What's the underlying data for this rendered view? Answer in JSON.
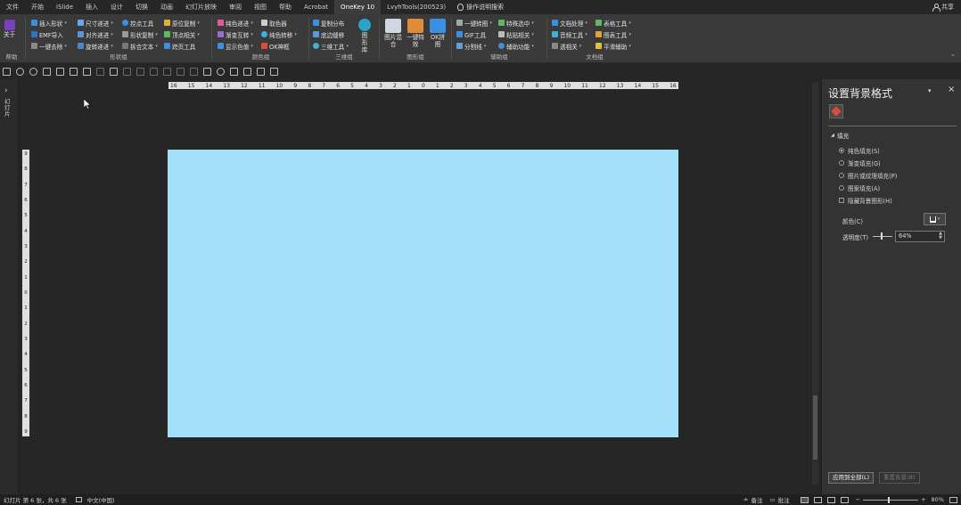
{
  "tabs": [
    "文件",
    "开始",
    "iSlide",
    "插入",
    "设计",
    "切换",
    "动画",
    "幻灯片放映",
    "审阅",
    "视图",
    "帮助",
    "Acrobat",
    "OneKey 10",
    "LvyhTools(200523)"
  ],
  "active_tab": "OneKey 10",
  "search_label": "操作说明搜索",
  "share_label": "共享",
  "ribbon": {
    "help_group": {
      "button": "关于",
      "title": "帮助"
    },
    "shape_group": {
      "title": "形状组",
      "col1": [
        "插入形状",
        "EMF导入",
        "一键去除"
      ],
      "col2": [
        "尺寸递进",
        "对齐递进",
        "旋转递进"
      ],
      "col3": [
        "控点工具",
        "形状复制",
        "拆合文本"
      ],
      "col4": [
        "原位复制",
        "顶点相关",
        "跨页工具"
      ]
    },
    "color_group": {
      "title": "颜色组",
      "col1": [
        "纯色递进",
        "渐变互转",
        "显示色值"
      ],
      "col2": [
        "取色器",
        "纯色转移",
        "OK神框"
      ]
    },
    "three_d_group": {
      "title": "三维组",
      "col1": [
        "复制分布",
        "底边缝移",
        "三维工具"
      ],
      "big": "图形库"
    },
    "image_group": {
      "title": "图形组",
      "big1": "图片混合",
      "big2": "一键特效",
      "big3": "OK拼图"
    },
    "assist_group": {
      "title": "辅助组",
      "col1": [
        "一键转图",
        "GIF工具",
        "分割线"
      ],
      "col2": [
        "特殊选中",
        "粘贴相关",
        "辅助功能"
      ]
    },
    "doc_group": {
      "title": "文档组",
      "col1": [
        "文档处理",
        "音频工具",
        "透相关"
      ],
      "col2": [
        "表格工具",
        "图表工具",
        "平滑辅助"
      ]
    }
  },
  "left_pane": {
    "label": "幻灯片"
  },
  "hruler_ticks": [
    "16",
    "15",
    "14",
    "13",
    "12",
    "11",
    "10",
    "9",
    "8",
    "7",
    "6",
    "5",
    "4",
    "3",
    "2",
    "1",
    "0",
    "1",
    "2",
    "3",
    "4",
    "5",
    "6",
    "7",
    "8",
    "9",
    "10",
    "11",
    "12",
    "13",
    "14",
    "15",
    "16"
  ],
  "vruler_ticks": [
    "9",
    "8",
    "7",
    "6",
    "5",
    "4",
    "3",
    "2",
    "1",
    "0",
    "1",
    "2",
    "3",
    "4",
    "5",
    "6",
    "7",
    "8",
    "9"
  ],
  "slide": {
    "background_color": "#a4e0f9"
  },
  "format_pane": {
    "title": "设置背景格式",
    "section": "填充",
    "options": [
      "纯色填充(S)",
      "渐变填充(G)",
      "图片或纹理填充(P)",
      "图案填充(A)"
    ],
    "selected_option": "纯色填充(S)",
    "hide_bg_graphics": "隐藏背景图形(H)",
    "color_label": "颜色(C)",
    "transparency_label": "透明度(T)",
    "transparency_value": "64%",
    "apply_all": "应用到全部(L)",
    "reset_bg": "重置背景(B)"
  },
  "status": {
    "slide_info": "幻灯片 第 6 张，共 6 张",
    "language": "中文(中国)",
    "notes": "备注",
    "comments": "批注",
    "zoom": "80%"
  }
}
